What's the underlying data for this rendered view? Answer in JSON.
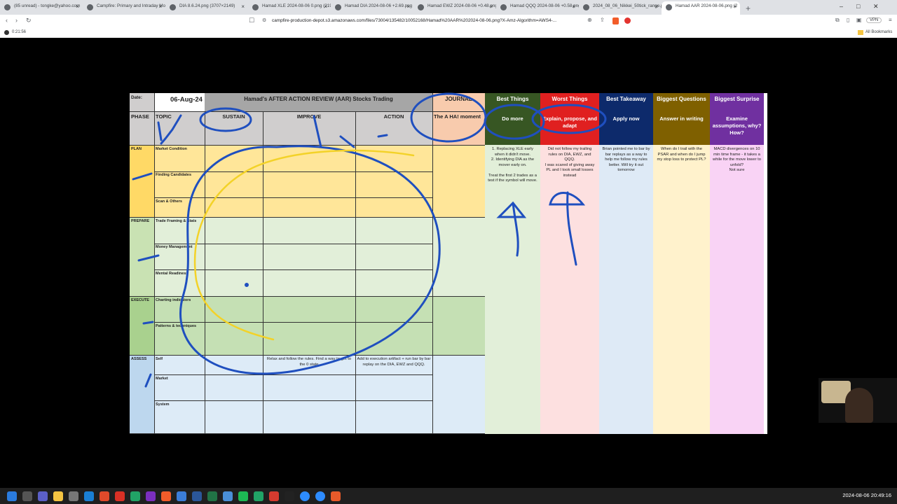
{
  "browser": {
    "tabs": [
      {
        "label": "(85 unread) - tongke@yahoo.com"
      },
      {
        "label": "Campfire: Primary and Intraday Mo"
      },
      {
        "label": "DIA 8.6.24.png (3707×2149)"
      },
      {
        "label": "Hamad XLE 2024-08-06 0.png (219"
      },
      {
        "label": "Hamad DIA 2024-08-06 +2.69.png"
      },
      {
        "label": "Hamad EWZ 2024-08-06 +0.48.png"
      },
      {
        "label": "Hamad QQQ 2024-08-06 +0.58.png"
      },
      {
        "label": "2024_08_06_Nikkei_50tick_range.p"
      },
      {
        "label": "Hamad AAR 2024-08-06.png (2"
      }
    ],
    "new_tab": "+",
    "url": "campfire-production-depot.s3.amazonaws.com/files/73004/135482/10052168/Hamad%20AAR%202024-08-06.png?X-Amz-Algorithm=AWS4-...",
    "vpn": "VPN",
    "all_bookmarks": "All Bookmarks",
    "recording_time": "0:21:56"
  },
  "aar": {
    "date_label": "Date:",
    "date": "06-Aug-24",
    "title": "Hamad's AFTER ACTION REVIEW (AAR) Stocks Trading",
    "journal": "JOURNAL",
    "phase": "PHASE",
    "topic": "TOPIC",
    "sustain": "SUSTAIN",
    "improve": "IMPROVE",
    "action": "ACTION",
    "aha": "The A HA! moment",
    "phases": {
      "plan": "PLAN",
      "prepare": "PREPARE",
      "execute": "EXECUTE",
      "assess": "ASSESS"
    },
    "topics": [
      "Market Condition",
      "Finding Candidates",
      "Scan & Others",
      "Trade Framing & Stats",
      "Money Management",
      "Mental Readiness",
      "Charting indicators",
      "Patterns & techniques",
      "Self",
      "Market",
      "System"
    ],
    "improve_self": "Relax and follow the rules. Find a way to get to the 0 state",
    "action_self": "Add to execution artifact + run bar by bar replay on the DIA, EWZ and QQQ.",
    "cols": [
      {
        "title": "Best Things",
        "sub": "Do more",
        "color": "#375623",
        "body": "1. Replacing XLE early when it didn't move.\n2. Identifying DIA as the mover early on.\n\nTreat the first 2 trades as a test if the symbol will move."
      },
      {
        "title": "Worst Things",
        "sub": "Explain, propose, and adapt",
        "color": "#e02020",
        "body": "Did not follow my trailing rules on DIA, EWZ, and QQQ.\nI was scared of giving away PL and I took small losses instead"
      },
      {
        "title": "Best Takeaway",
        "sub": "Apply now",
        "color": "#0d2a6b",
        "body": "Brian pointed me to bar by bar replays as a way to help me follow my rules better. Will try it out tomorrow"
      },
      {
        "title": "Biggest Questions",
        "sub": "Answer in writing",
        "color": "#7f6000",
        "body": "When do I trail with the PSAR and when do I jump my stop loss to protect PL?"
      },
      {
        "title": "Biggest Surprise",
        "sub": "Examine assumptions, why? How?",
        "color": "#7030a0",
        "body": "MACD divergences on 10 min time frame - it takes a while for the move lower to unfold?\nNot sure"
      }
    ]
  },
  "taskbar": {
    "date": "2024-08-06",
    "time": "20:49:16"
  }
}
